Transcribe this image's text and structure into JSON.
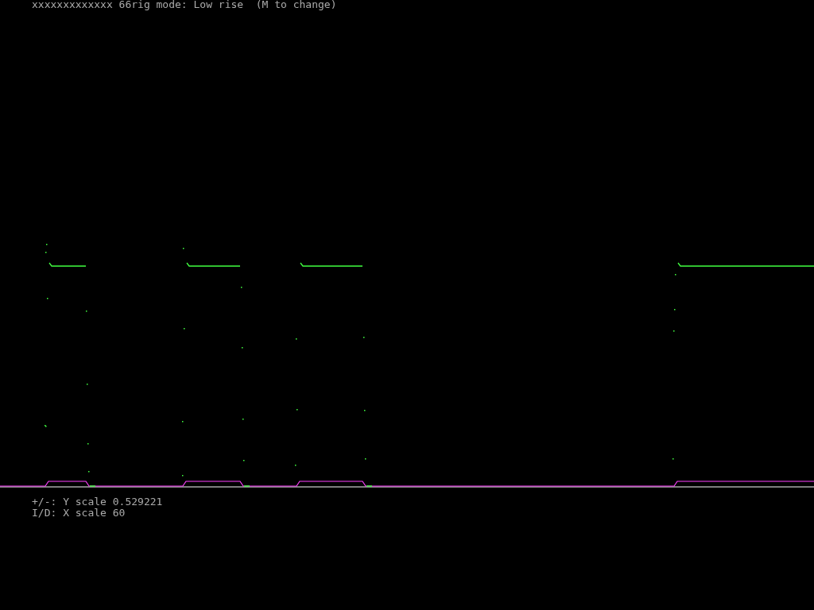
{
  "status_line": "xxxxxxxxxxxxx 66rig mode: Low rise  (M to change)",
  "key_hints": [
    "+/-: Y scale 0.529221",
    "I/D: X scale 60"
  ]
}
